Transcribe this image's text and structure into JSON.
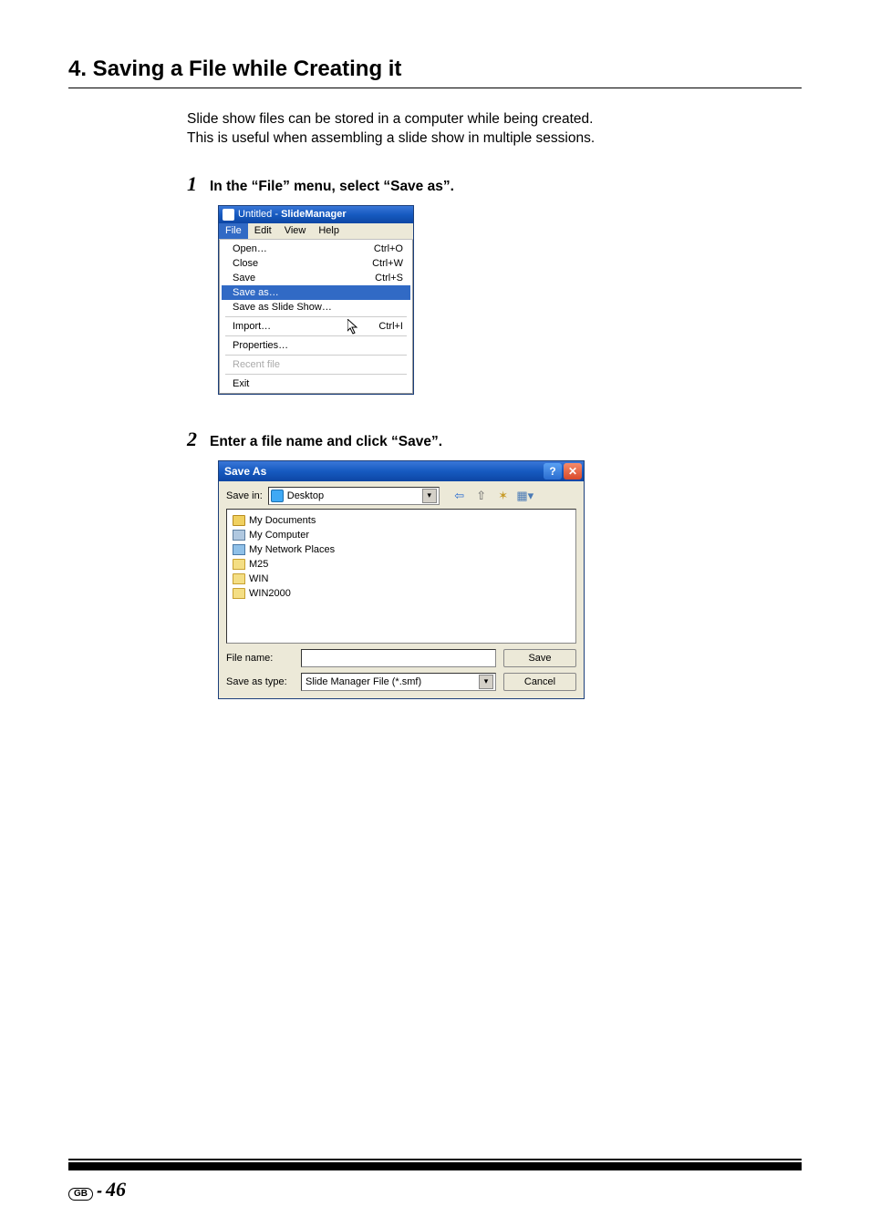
{
  "section_title": "4. Saving a File while Creating it",
  "intro_line1": "Slide show files can be stored in a computer while being created.",
  "intro_line2": "This is useful when assembling a slide show in multiple sessions.",
  "step1": {
    "num": "1",
    "text": "In the “File” menu, select “Save as”."
  },
  "step2": {
    "num": "2",
    "text": "Enter a file name and click “Save”."
  },
  "window1": {
    "title_pre": "Untitled - ",
    "title_bold": "SlideManager",
    "menubar": {
      "file": "File",
      "edit": "Edit",
      "view": "View",
      "help": "Help"
    },
    "menu": {
      "open": "Open…",
      "open_sc": "Ctrl+O",
      "close": "Close",
      "close_sc": "Ctrl+W",
      "save": "Save",
      "save_sc": "Ctrl+S",
      "saveas": "Save as…",
      "save_slide": "Save as Slide Show…",
      "import": "Import…",
      "import_sc": "Ctrl+I",
      "properties": "Properties…",
      "recent": "Recent file",
      "exit": "Exit"
    }
  },
  "window2": {
    "title": "Save As",
    "savein_label": "Save in:",
    "savein_value": "Desktop",
    "items": [
      {
        "icon": "folder-special",
        "name": "My Documents"
      },
      {
        "icon": "computer",
        "name": "My Computer"
      },
      {
        "icon": "network",
        "name": "My Network Places"
      },
      {
        "icon": "folder",
        "name": "M25"
      },
      {
        "icon": "folder",
        "name": "WIN"
      },
      {
        "icon": "folder",
        "name": "WIN2000"
      }
    ],
    "filename_label": "File name:",
    "filename_value": "",
    "saveastype_label": "Save as type:",
    "saveastype_value": "Slide Manager File (*.smf)",
    "save_btn": "Save",
    "cancel_btn": "Cancel"
  },
  "footer": {
    "region": "GB",
    "page": "46"
  }
}
